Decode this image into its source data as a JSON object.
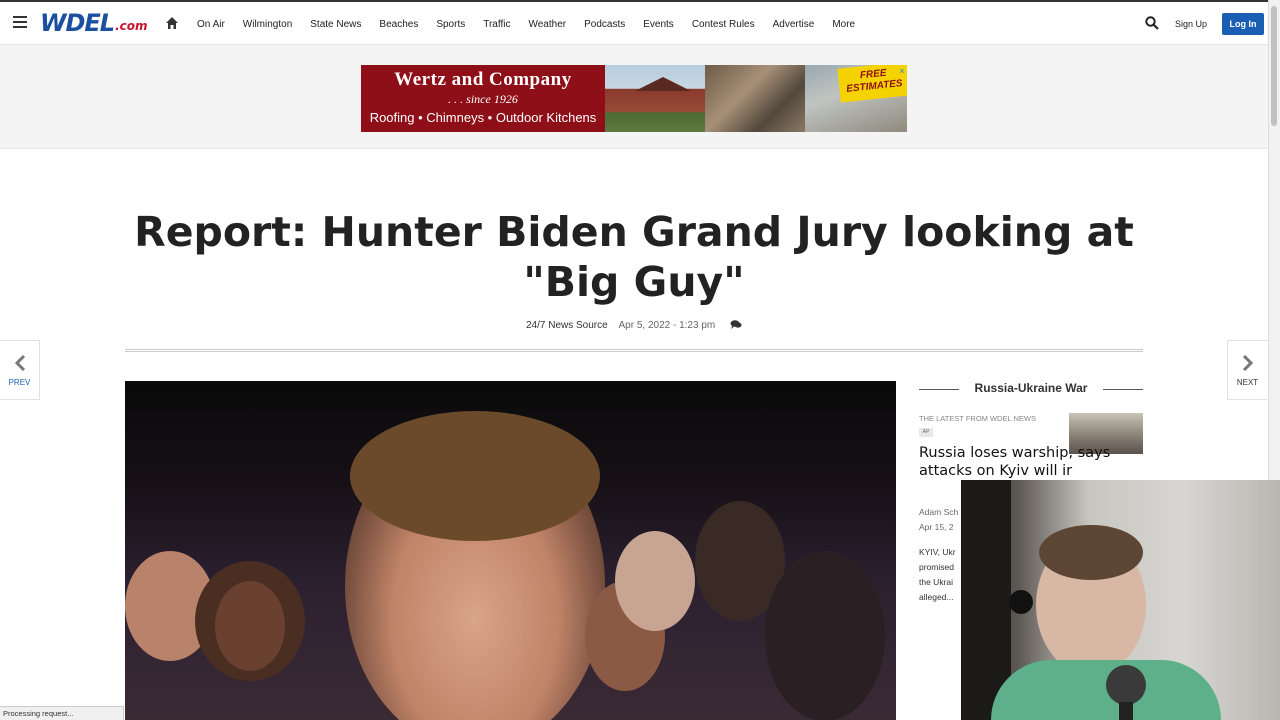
{
  "header": {
    "logo_text": "WDEL",
    "logo_suffix": ".com",
    "nav_items": [
      "On Air",
      "Wilmington",
      "State News",
      "Beaches",
      "Sports",
      "Traffic",
      "Weather",
      "Podcasts",
      "Events",
      "Contest Rules",
      "Advertise",
      "More"
    ],
    "signup_label": "Sign Up",
    "login_label": "Log In"
  },
  "ad": {
    "title": "Wertz and Company",
    "since": ". . . since 1926",
    "services": "Roofing • Chimneys • Outdoor Kitchens",
    "badge": "FREE ESTIMATES",
    "close": "×"
  },
  "article": {
    "headline": "Report: Hunter Biden Grand Jury looking at \"Big Guy\"",
    "source": "24/7 News Source",
    "date": "Apr 5, 2022 - 1:23 pm"
  },
  "pager": {
    "prev_label": "PREV",
    "next_label": "NEXT"
  },
  "sidebar": {
    "section_title": "Russia-Ukraine War",
    "latest_label": "THE LATEST FROM WDEL NEWS",
    "tag": "AP",
    "story_title": "Russia loses warship, says attacks on Kyiv will ir",
    "author": "Adam Sch",
    "date": "Apr 15, 2",
    "excerpt": [
      "KYIV, Ukr",
      "promised",
      "the Ukrai",
      "alleged..."
    ]
  },
  "status_bar": {
    "text": "Processing request..."
  },
  "colors": {
    "brand_blue": "#1a5fb4",
    "ad_red": "#8e0f17",
    "badge_yellow": "#f5d300"
  }
}
